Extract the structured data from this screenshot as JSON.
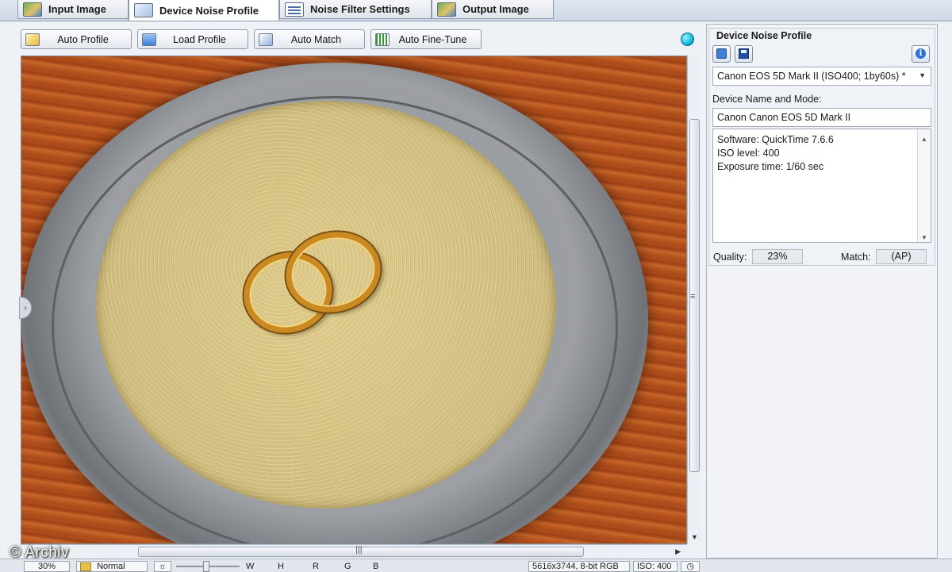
{
  "tabs": [
    {
      "label": "Input Image"
    },
    {
      "label": "Device Noise Profile"
    },
    {
      "label": "Noise Filter Settings"
    },
    {
      "label": "Output Image"
    }
  ],
  "toolbar": {
    "auto_profile": "Auto Profile",
    "load_profile": "Load Profile",
    "auto_match": "Auto Match",
    "auto_fine_tune": "Auto Fine-Tune"
  },
  "panel": {
    "title": "Device Noise Profile",
    "profile_combo": "Canon EOS 5D Mark II (ISO400; 1by60s) *",
    "device_label": "Device Name and Mode:",
    "device_value": "Canon Canon EOS 5D Mark II",
    "info_lines": [
      "Software: QuickTime 7.6.6",
      "ISO level: 400",
      "Exposure time: 1/60 sec"
    ],
    "quality_label": "Quality:",
    "quality_value": "23%",
    "match_label": "Match:",
    "match_value": "(AP)",
    "info_button": "i"
  },
  "statusbar": {
    "zoom": "30%",
    "mode": "Normal",
    "text1": "W",
    "text2": "H",
    "text3": "R",
    "text4": "G",
    "text5": "B",
    "image_info": "5616x3744, 8-bit RGB",
    "iso": "ISO: 400"
  },
  "watermark": "© Archiv",
  "colors": {
    "accent_dot": "#12b8d8",
    "panel_bg": "#f1f3f6",
    "tab_bg": "#dfe4eb"
  }
}
